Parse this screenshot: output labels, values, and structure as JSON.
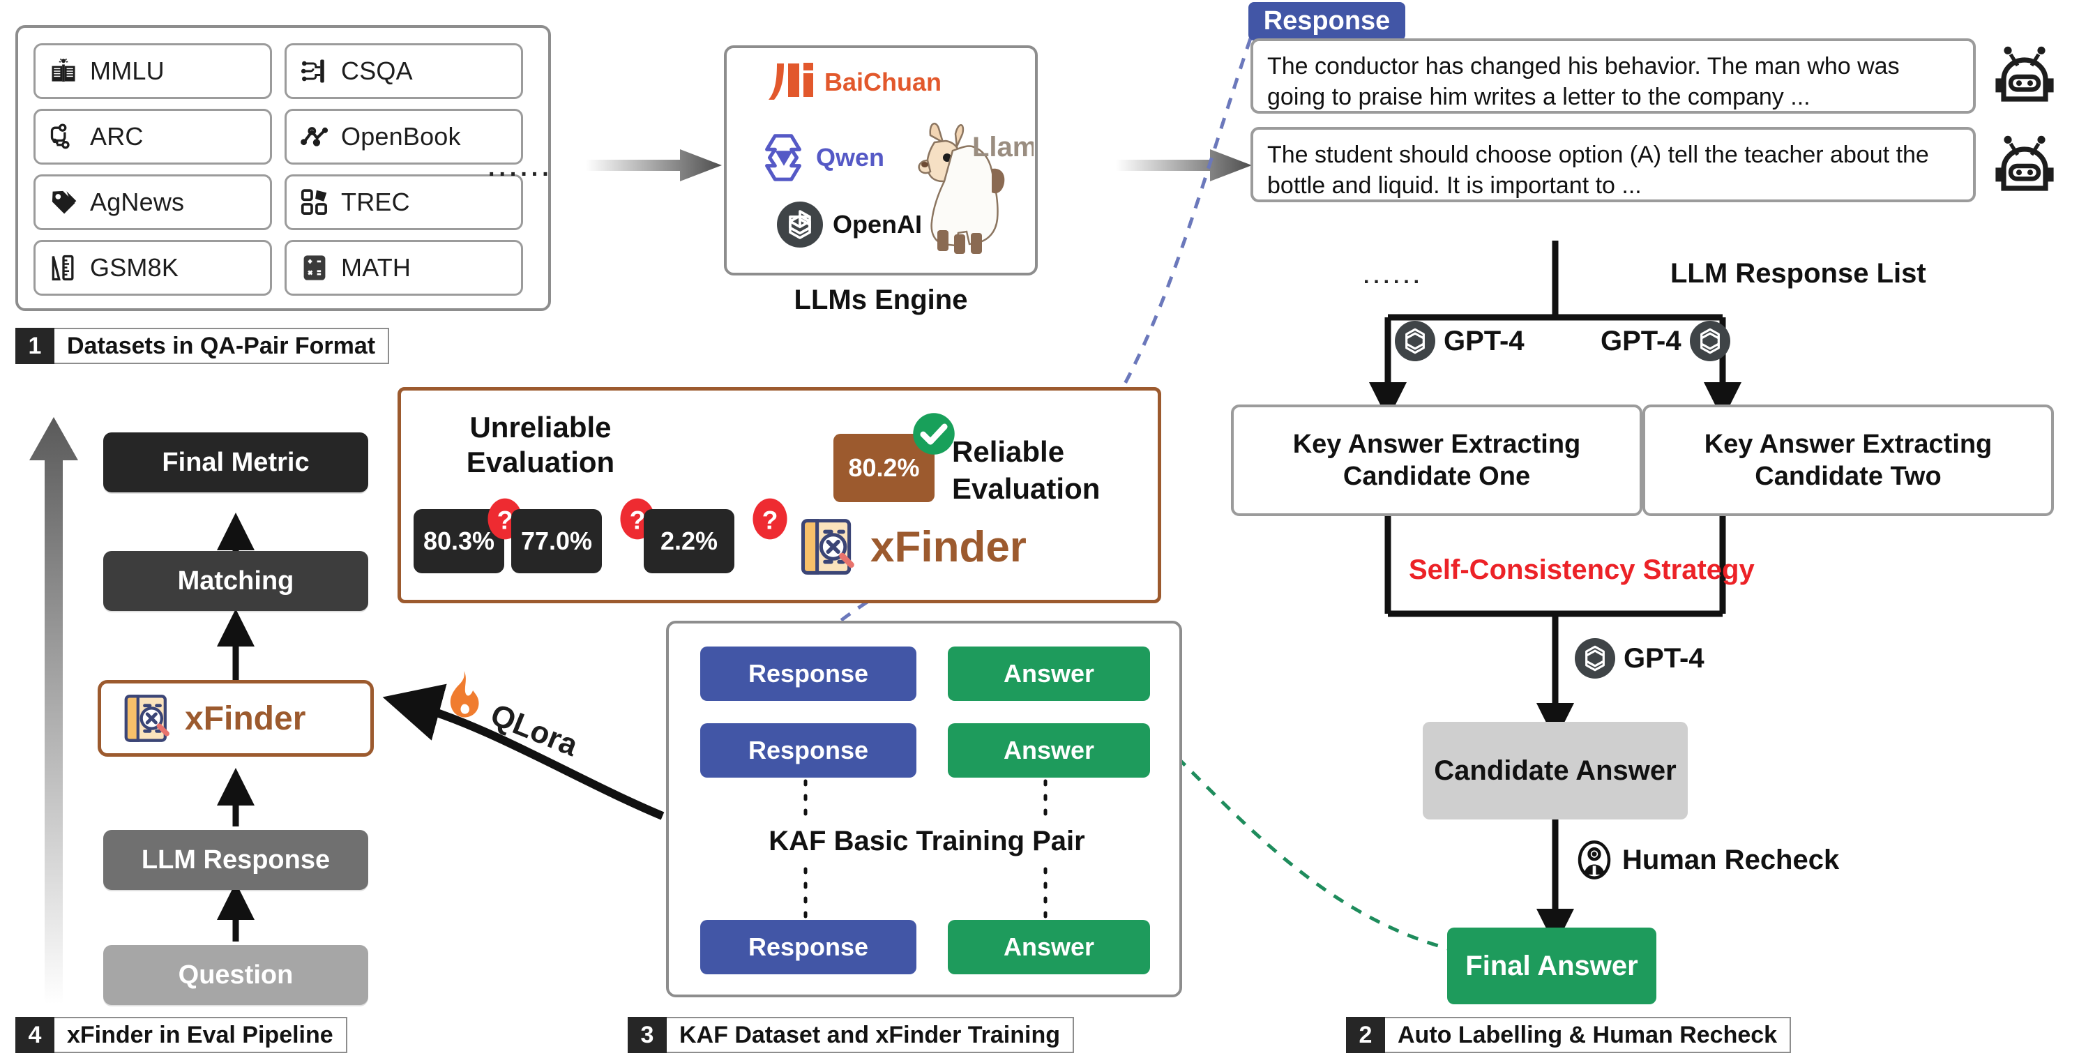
{
  "colors": {
    "blue": "#4256a6",
    "green": "#1e9b5c",
    "brown": "#9c5a2e",
    "red": "#ec2227",
    "dark": "#262626",
    "mid_gray": "#4d4d4d",
    "light_gray": "#a6a6a6",
    "box_gray": "#cfcfcf",
    "border_gray": "#8d8d8d"
  },
  "section1": {
    "caption_num": "1",
    "caption_text": "Datasets in QA-Pair Format",
    "datasets": [
      {
        "name": "MMLU",
        "icon": "open-book-idea-icon"
      },
      {
        "name": "CSQA",
        "icon": "circuit-nodes-icon"
      },
      {
        "name": "ARC",
        "icon": "node-graph-icon"
      },
      {
        "name": "OpenBook",
        "icon": "molecule-nodes-icon"
      },
      {
        "name": "AgNews",
        "icon": "price-tag-icon"
      },
      {
        "name": "TREC",
        "icon": "category-squares-icon"
      },
      {
        "name": "GSM8K",
        "icon": "ruler-icon"
      },
      {
        "name": "MATH",
        "icon": "calculator-icon"
      }
    ],
    "ellipsis": "......"
  },
  "engine": {
    "title": "LLMs Engine",
    "models": [
      {
        "name": "BaiChuan",
        "icon": "baichuan-logo"
      },
      {
        "name": "Qwen",
        "icon": "qwen-logo"
      },
      {
        "name": "Llama",
        "icon": "llama-logo"
      },
      {
        "name": "OpenAI",
        "icon": "openai-logo"
      }
    ]
  },
  "responses": {
    "badge": "Response",
    "list_label": "LLM Response List",
    "ellipsis": "......",
    "items": [
      {
        "text": "The conductor has changed his behavior. The man who was going to praise him writes a letter to the company ...",
        "icon": "robot-icon"
      },
      {
        "text": "The student should choose option (A) tell the teacher about the bottle and liquid. It is important to ...",
        "icon": "robot-icon"
      }
    ]
  },
  "section2": {
    "caption_num": "2",
    "caption_text": "Auto Labelling & Human Recheck",
    "gpt_label_left": "GPT-4",
    "gpt_label_right": "GPT-4",
    "gpt_label_mid": "GPT-4",
    "gpt_icon": "openai-logo",
    "candidate_one": "Key Answer Extracting\nCandidate One",
    "candidate_one_line1": "Key Answer Extracting",
    "candidate_one_line2": "Candidate One",
    "candidate_two_line1": "Key Answer Extracting",
    "candidate_two_line2": "Candidate Two",
    "strategy": "Self-Consistency Strategy",
    "candidate_answer": "Candidate Answer",
    "human_recheck": "Human Recheck",
    "human_icon": "person-circle-icon",
    "final_answer": "Final Answer"
  },
  "section3": {
    "caption_num": "3",
    "caption_text": "KAF Dataset and xFinder Training",
    "pair_label": "KAF Basic Training Pair",
    "rows": [
      {
        "response": "Response",
        "answer": "Answer"
      },
      {
        "response": "Response",
        "answer": "Answer"
      },
      {
        "response": "Response",
        "answer": "Answer"
      }
    ],
    "qlora_label": "QLora",
    "qlora_icon": "flame-icon"
  },
  "section4": {
    "caption_num": "4",
    "caption_text": "xFinder in Eval Pipeline",
    "steps": [
      {
        "label": "Final Metric",
        "bg": "#262626"
      },
      {
        "label": "Matching",
        "bg": "#3d3d3d"
      },
      {
        "label": "xFinder",
        "bg": "#ffffff"
      },
      {
        "label": "LLM Response",
        "bg": "#707070"
      },
      {
        "label": "Question",
        "bg": "#a6a6a6"
      }
    ],
    "xfinder_label": "xFinder",
    "xfinder_icon": "xfinder-logo"
  },
  "evaluation": {
    "unreliable_line1": "Unreliable",
    "unreliable_line2": "Evaluation",
    "reliable_line1": "Reliable",
    "reliable_line2": "Evaluation",
    "unreliable_values": [
      "80.3%",
      "77.0%",
      "2.2%"
    ],
    "reliable_value": "80.2%",
    "question_icon": "question-mark-badge",
    "check_icon": "check-badge",
    "xfinder_label": "xFinder",
    "xfinder_icon": "xfinder-logo"
  }
}
